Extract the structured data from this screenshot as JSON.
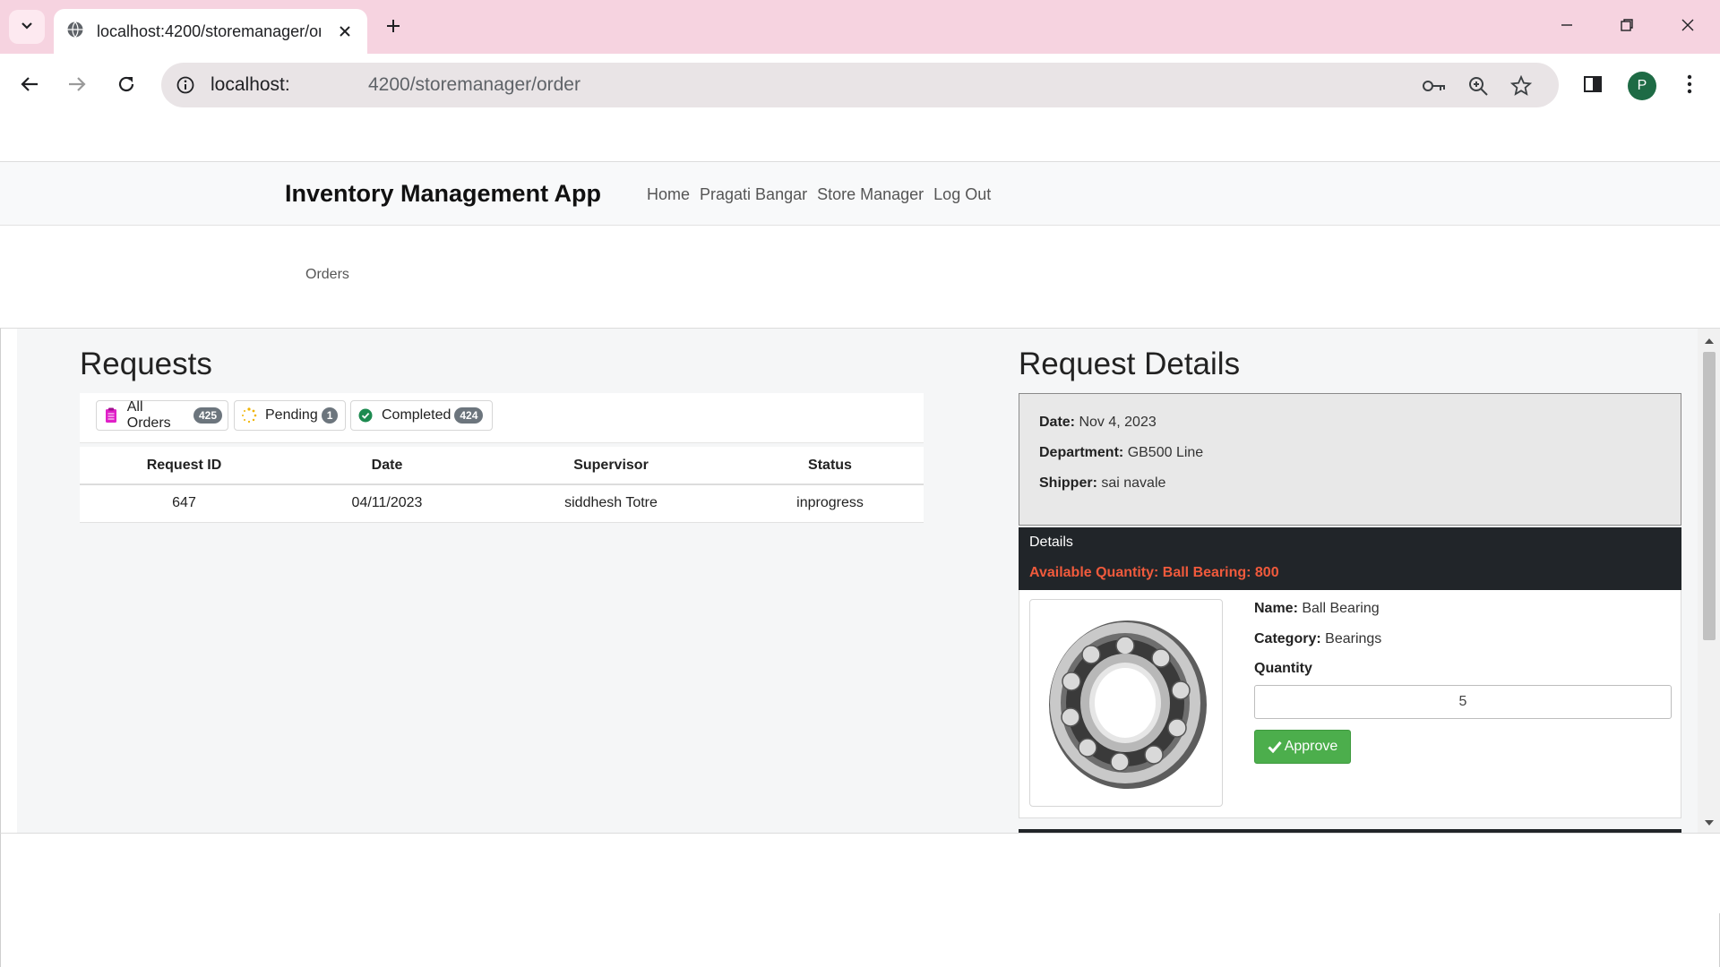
{
  "browser": {
    "tab_title": "localhost:4200/storemanager/order",
    "url_host": "localhost:",
    "url_path": "4200/storemanager/order",
    "profile_initial": "P",
    "tabstrip_color": "#f6d3e0"
  },
  "navbar": {
    "brand": "Inventory Management App",
    "links": [
      "Home",
      "Pragati Bangar",
      "Store Manager",
      "Log Out"
    ]
  },
  "breadcrumb": "Orders",
  "requests": {
    "title": "Requests",
    "filters": [
      {
        "label": "All Orders",
        "count": "425",
        "icon": "clipboard-icon",
        "color": "#e020c8"
      },
      {
        "label": "Pending",
        "count": "1",
        "icon": "spinner-icon",
        "color": "#f0b400"
      },
      {
        "label": "Completed",
        "count": "424",
        "icon": "check-circle-icon",
        "color": "#1d8a50"
      }
    ],
    "columns": [
      "Request ID",
      "Date",
      "Supervisor",
      "Status"
    ],
    "rows": [
      [
        "647",
        "04/11/2023",
        "siddhesh Totre",
        "inprogress"
      ]
    ]
  },
  "details": {
    "title": "Request Details",
    "date_label": "Date:",
    "date_value": "Nov 4, 2023",
    "department_label": "Department:",
    "department_value": "GB500 Line",
    "shipper_label": "Shipper:",
    "shipper_value": "sai navale",
    "section_title": "Details",
    "available_text": "Available Quantity: Ball Bearing: 800",
    "item": {
      "name_label": "Name:",
      "name_value": "Ball Bearing",
      "category_label": "Category:",
      "category_value": "Bearings",
      "quantity_label": "Quantity",
      "quantity_value": "5",
      "approve_label": "Approve"
    }
  }
}
